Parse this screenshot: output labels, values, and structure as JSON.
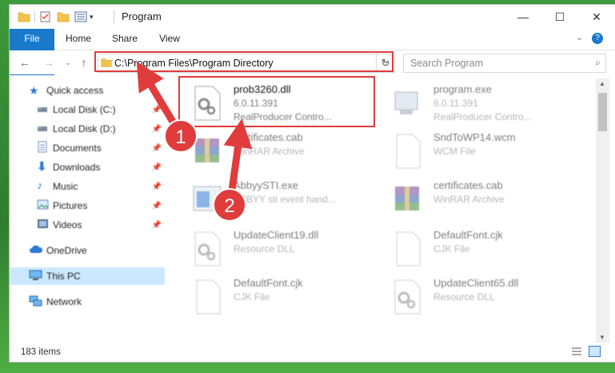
{
  "window": {
    "title": "Program",
    "controls": {
      "minimize": "—",
      "maximize": "☐",
      "close": "✕"
    }
  },
  "ribbon": {
    "tabs": [
      {
        "label": "File"
      },
      {
        "label": "Home"
      },
      {
        "label": "Share"
      },
      {
        "label": "View"
      }
    ]
  },
  "address": {
    "path": "C:\\Program Files\\Program Directory"
  },
  "search": {
    "placeholder": "Search Program"
  },
  "sidebar": {
    "items": [
      {
        "label": "Quick access",
        "icon": "star-icon"
      },
      {
        "label": "Local Disk (C:)",
        "icon": "drive-icon",
        "pinned": true
      },
      {
        "label": "Local Disk (D:)",
        "icon": "drive-icon",
        "pinned": true
      },
      {
        "label": "Documents",
        "icon": "documents-icon",
        "pinned": true
      },
      {
        "label": "Downloads",
        "icon": "download-icon",
        "pinned": true
      },
      {
        "label": "Music",
        "icon": "music-icon",
        "pinned": true
      },
      {
        "label": "Pictures",
        "icon": "pictures-icon",
        "pinned": true
      },
      {
        "label": "Videos",
        "icon": "videos-icon",
        "pinned": true
      },
      {
        "label": "OneDrive",
        "icon": "cloud-icon"
      },
      {
        "label": "This PC",
        "icon": "pc-icon",
        "selected": true
      },
      {
        "label": "Network",
        "icon": "network-icon"
      }
    ]
  },
  "files": [
    {
      "name": "prob3260.dll",
      "line2": "6.0.11.391",
      "line3": "RealProducer Contro...",
      "icon": "dll-gear-icon"
    },
    {
      "name": "program.exe",
      "line2": "6.0.11.391",
      "line3": "RealProducer Contro...",
      "icon": "exe-icon"
    },
    {
      "name": "certificates.cab",
      "line2": "WinRAR Archive",
      "line3": "",
      "icon": "winrar-icon"
    },
    {
      "name": "SndToWP14.wcm",
      "line2": "WCM File",
      "line3": "",
      "icon": "blank-file-icon"
    },
    {
      "name": "AbbyySTI.exe",
      "line2": "ABBYY sti event hand...",
      "line3": "",
      "icon": "exe-app-icon"
    },
    {
      "name": "certificates.cab",
      "line2": "WinRAR Archive",
      "line3": "",
      "icon": "winrar-icon"
    },
    {
      "name": "UpdateClient19.dll",
      "line2": "Resource DLL",
      "line3": "",
      "icon": "dll-gear-icon"
    },
    {
      "name": "DefaultFont.cjk",
      "line2": "CJK File",
      "line3": "",
      "icon": "blank-file-icon"
    },
    {
      "name": "DefaultFont.cjk",
      "line2": "CJK File",
      "line3": "",
      "icon": "blank-file-icon"
    },
    {
      "name": "UpdateClient65.dll",
      "line2": "Resource DLL",
      "line3": "",
      "icon": "dll-gear-icon"
    }
  ],
  "status": {
    "count": "183 items"
  },
  "annotations": {
    "step1": "1",
    "step2": "2",
    "color": "#e03c3c"
  }
}
